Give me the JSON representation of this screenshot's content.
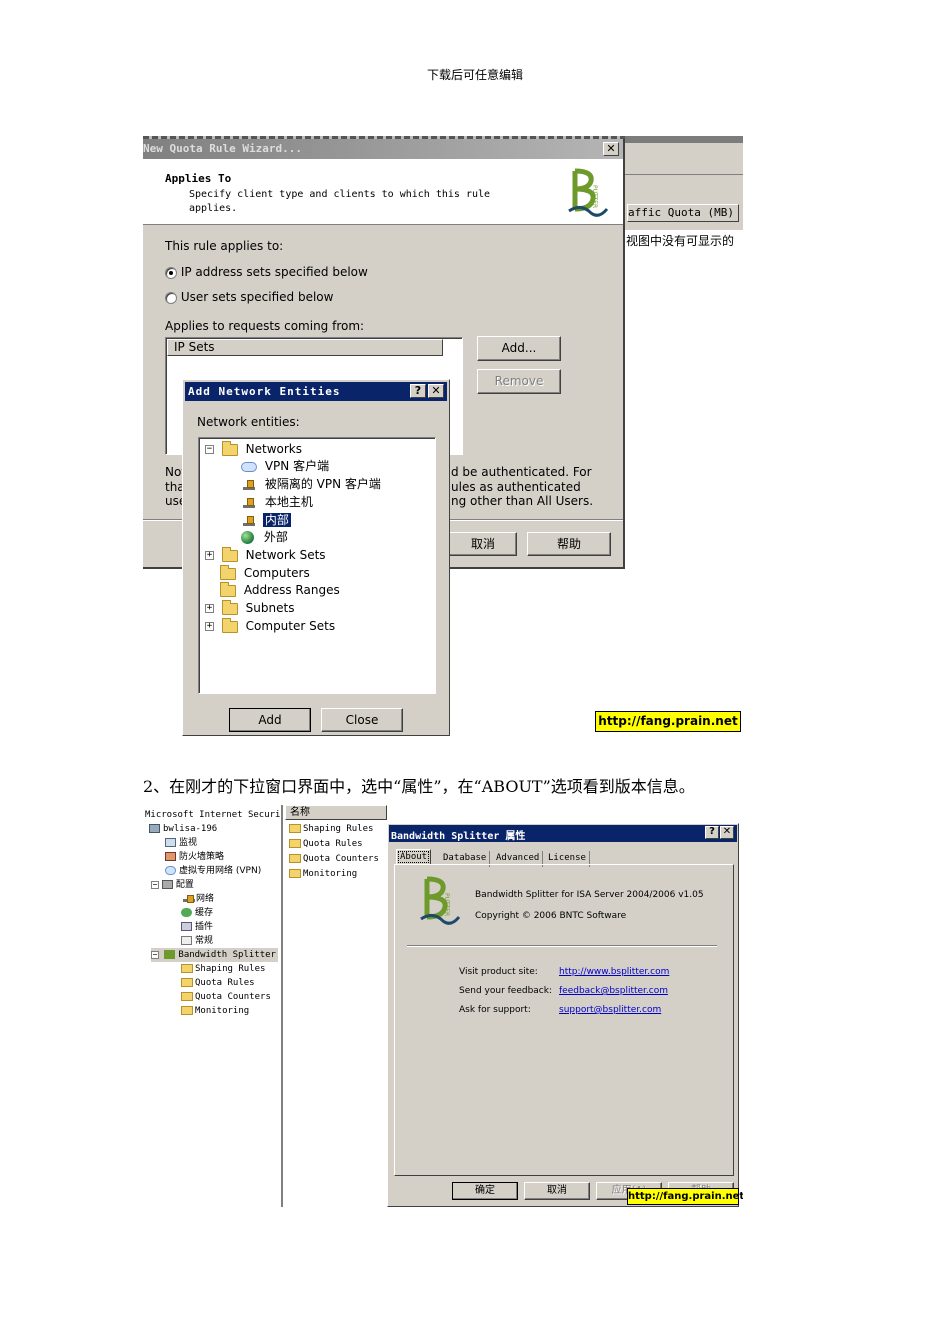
{
  "header": {
    "note": "下载后可任意编辑"
  },
  "shot1": {
    "wizard": {
      "title": "New Quota Rule Wizard...",
      "heading": "Applies To",
      "subheading": "Specify client type and clients to which this rule applies.",
      "applies_label": "This rule applies to:",
      "radio1": "IP address sets specified below",
      "radio2": "User sets specified below",
      "requests_label": "Applies to requests coming from:",
      "list_header": "IP Sets",
      "add_button": "Add...",
      "remove_button": "Remove",
      "note_left": [
        "Not",
        "tha",
        "use"
      ],
      "note_right": [
        "d be authenticated. For",
        "ules as authenticated",
        "ng other than All Users."
      ],
      "cancel_button": "取消",
      "help_button": "帮助"
    },
    "background": {
      "column_header": "affic Quota (MB)",
      "empty_text": "视图中没有可显示的"
    },
    "dialog": {
      "title": "Add Network Entities",
      "label": "Network entities:",
      "tree": {
        "networks": "Networks",
        "children": [
          "VPN 客户端",
          "被隔离的 VPN 客户端",
          "本地主机",
          "内部",
          "外部"
        ],
        "others": [
          "Network Sets",
          "Computers",
          "Address Ranges",
          "Subnets",
          "Computer Sets"
        ]
      },
      "add_button": "Add",
      "close_button": "Close"
    },
    "watermark": "http://fang.prain.net"
  },
  "instruction": "2、在刚才的下拉窗口界面中，选中“属性”，在“ABOUT”选项看到版本信息。",
  "shot2": {
    "left_tree": {
      "root": "Microsoft Internet Securi",
      "server": "bwlisa-196",
      "items": [
        "监视",
        "防火墙策略",
        "虚拟专用网络 (VPN)",
        "配置",
        "网络",
        "缓存",
        "插件",
        "常规"
      ],
      "bs": "Bandwidth Splitter",
      "bs_children": [
        "Shaping Rules",
        "Quota Rules",
        "Quota Counters",
        "Monitoring"
      ]
    },
    "middle": {
      "header": "名称",
      "items": [
        "Shaping Rules",
        "Quota Rules",
        "Quota Counters",
        "Monitoring"
      ]
    },
    "props": {
      "title": "Bandwidth Splitter 属性",
      "tabs": [
        "About",
        "Database",
        "Advanced",
        "License"
      ],
      "product": "Bandwidth Splitter for ISA Server 2004/2006 v1.05",
      "copyright": "Copyright © 2006 BNTC Software",
      "rows": [
        {
          "label": "Visit product site:",
          "value": "http://www.bsplitter.com"
        },
        {
          "label": "Send your feedback:",
          "value": "feedback@bsplitter.com"
        },
        {
          "label": "Ask for support:",
          "value": "support@bsplitter.com"
        }
      ],
      "ok_button": "确定",
      "cancel_button": "取消",
      "apply_button": "应用(A)",
      "help_button": "帮助"
    },
    "watermark": "http://fang.prain.net"
  },
  "colors": {
    "titlebar": "#0a246a",
    "window": "#d4d0c8",
    "logo_green": "#6d9a2a",
    "watermark_bg": "#ffff00"
  }
}
